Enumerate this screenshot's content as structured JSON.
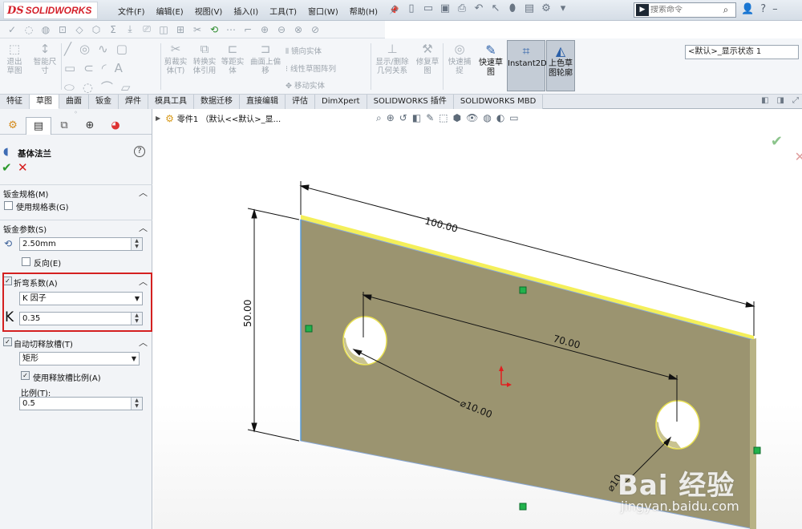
{
  "app": {
    "logo_ds": "DS",
    "logo_text": "SOLIDWORKS"
  },
  "menu": [
    "文件(F)",
    "编辑(E)",
    "视图(V)",
    "插入(I)",
    "工具(T)",
    "窗口(W)",
    "帮助(H)"
  ],
  "search": {
    "placeholder": "搜索命令"
  },
  "ribbon": {
    "exit_sketch": "退出草图",
    "smart_dim": "智能尺寸",
    "trim": "剪裁实体(T)",
    "convert": "转换实体引用",
    "offset": "等距实体",
    "surface_offset": "曲面上偏移",
    "mirror": "镜向实体",
    "linear_pattern": "线性草图阵列",
    "move": "移动实体",
    "relations": "显示/删除几何关系",
    "repair": "修复草图",
    "quick_snap": "快速捕捉",
    "rapid_sketch": "快速草图",
    "instant2d": "Instant2D",
    "shaded_contour": "上色草图轮廓",
    "display_state": "<默认>_显示状态 1"
  },
  "tabs": [
    {
      "label": "特征",
      "active": false
    },
    {
      "label": "草图",
      "active": true
    },
    {
      "label": "曲面",
      "active": false
    },
    {
      "label": "钣金",
      "active": false
    },
    {
      "label": "焊件",
      "active": false
    },
    {
      "label": "模具工具",
      "active": false
    },
    {
      "label": "数据迁移",
      "active": false
    },
    {
      "label": "直接编辑",
      "active": false
    },
    {
      "label": "评估",
      "active": false
    },
    {
      "label": "DimXpert",
      "active": false
    },
    {
      "label": "SOLIDWORKS 插件",
      "active": false
    },
    {
      "label": "SOLIDWORKS MBD",
      "active": false
    }
  ],
  "panel": {
    "feature_title": "基体法兰",
    "gauge_section": "钣金规格(M)",
    "use_gauge_table": "使用规格表(G)",
    "params_section": "钣金参数(S)",
    "thickness": "2.50mm",
    "reverse": "反向(E)",
    "bend_section": "折弯系数(A)",
    "bend_type": "K 因子",
    "k_label": "K",
    "k_value": "0.35",
    "relief_section": "自动切释放槽(T)",
    "relief_type": "矩形",
    "use_relief_ratio": "使用释放槽比例(A)",
    "ratio_label": "比例(T):",
    "ratio_value": "0.5"
  },
  "graphics": {
    "breadcrumb": "零件1 （默认<<默认>_显...",
    "dim_length": "100.00",
    "dim_height": "50.00",
    "dim_spacing": "70.00",
    "dim_diameter": "⌀10.00",
    "dim_diameter2": "⌀10"
  },
  "watermark": {
    "big": "Bai 经验",
    "small": "jingyan.baidu.com"
  },
  "colors": {
    "plate_fill": "#9b9470",
    "plate_edge_highlight": "#f2ee5a",
    "dimension_line": "#000000",
    "highlight_box": "#d42020",
    "brand_red": "#d4202a"
  }
}
